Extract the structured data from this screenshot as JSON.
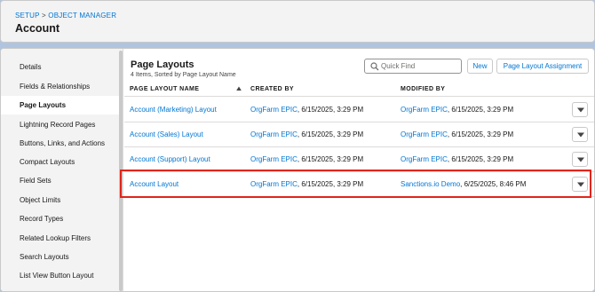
{
  "header": {
    "breadcrumb_setup": "SETUP",
    "breadcrumb_sep": ">",
    "breadcrumb_object_manager": "OBJECT MANAGER",
    "title": "Account"
  },
  "sidebar": {
    "items": [
      {
        "label": "Details"
      },
      {
        "label": "Fields & Relationships"
      },
      {
        "label": "Page Layouts"
      },
      {
        "label": "Lightning Record Pages"
      },
      {
        "label": "Buttons, Links, and Actions"
      },
      {
        "label": "Compact Layouts"
      },
      {
        "label": "Field Sets"
      },
      {
        "label": "Object Limits"
      },
      {
        "label": "Record Types"
      },
      {
        "label": "Related Lookup Filters"
      },
      {
        "label": "Search Layouts"
      },
      {
        "label": "List View Button Layout"
      }
    ],
    "active_index": 2
  },
  "main": {
    "title": "Page Layouts",
    "subtitle": "4 Items, Sorted by Page Layout Name",
    "quick_find_placeholder": "Quick Find",
    "new_button": "New",
    "assignment_button": "Page Layout Assignment",
    "columns": [
      "PAGE LAYOUT NAME",
      "CREATED BY",
      "MODIFIED BY"
    ],
    "rows": [
      {
        "name": "Account (Marketing) Layout",
        "created_user": "OrgFarm EPIC",
        "created_date": ", 6/15/2025, 3:29 PM",
        "modified_user": "OrgFarm EPIC",
        "modified_date": ", 6/15/2025, 3:29 PM"
      },
      {
        "name": "Account (Sales) Layout",
        "created_user": "OrgFarm EPIC",
        "created_date": ", 6/15/2025, 3:29 PM",
        "modified_user": "OrgFarm EPIC",
        "modified_date": ", 6/15/2025, 3:29 PM"
      },
      {
        "name": "Account (Support) Layout",
        "created_user": "OrgFarm EPIC",
        "created_date": ", 6/15/2025, 3:29 PM",
        "modified_user": "OrgFarm EPIC",
        "modified_date": ", 6/15/2025, 3:29 PM"
      },
      {
        "name": "Account Layout",
        "created_user": "OrgFarm EPIC",
        "created_date": ", 6/15/2025, 3:29 PM",
        "modified_user": "Sanctions.io Demo",
        "modified_date": ", 6/25/2025, 8:46 PM"
      }
    ],
    "highlighted_row": 3
  },
  "colors": {
    "link": "#0176d3",
    "highlight": "#e0251b",
    "background": "#b0c4df"
  },
  "icons": {
    "search": "search-icon",
    "sort": "sort-ascending-icon",
    "row_menu": "chevron-down-icon"
  }
}
